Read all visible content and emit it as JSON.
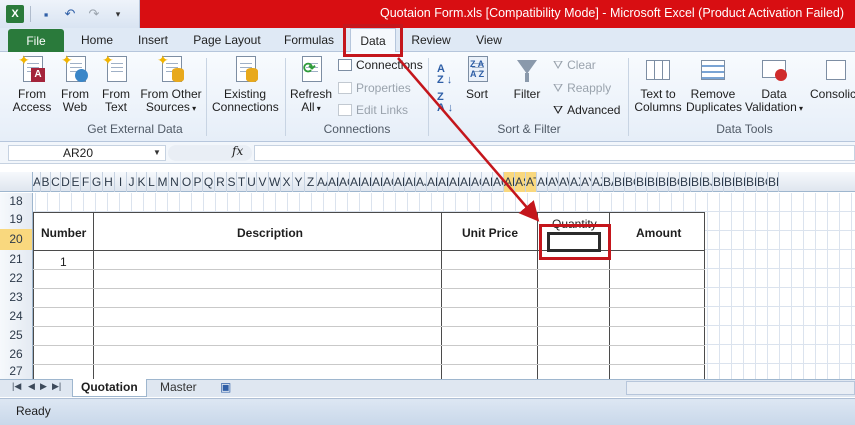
{
  "window": {
    "title": "Quotaion Form.xls  [Compatibility Mode]  -  Microsoft Excel (Product Activation Failed)"
  },
  "tabs": [
    {
      "label": "File"
    },
    {
      "label": "Home"
    },
    {
      "label": "Insert"
    },
    {
      "label": "Page Layout"
    },
    {
      "label": "Formulas"
    },
    {
      "label": "Data"
    },
    {
      "label": "Review"
    },
    {
      "label": "View"
    }
  ],
  "ribbon": {
    "external": {
      "from_access": "From Access",
      "from_web": "From Web",
      "from_text": "From Text",
      "from_other": "From Other Sources",
      "existing": "Existing Connections",
      "group": "Get External Data"
    },
    "connections": {
      "refresh": "Refresh All",
      "connections": "Connections",
      "properties": "Properties",
      "edit_links": "Edit Links",
      "group": "Connections"
    },
    "sort_filter": {
      "sort": "Sort",
      "filter": "Filter",
      "clear": "Clear",
      "reapply": "Reapply",
      "advanced": "Advanced",
      "group": "Sort & Filter"
    },
    "tools": {
      "text_to_columns": "Text to Columns",
      "remove_duplicates": "Remove Duplicates",
      "data_validation": "Data Validation",
      "consolidate": "Consolic",
      "group": "Data Tools"
    }
  },
  "formula": {
    "name_box": "AR20",
    "fx": "fx",
    "value": ""
  },
  "columns": [
    "A",
    "B",
    "C",
    "D",
    "E",
    "F",
    "G",
    "H",
    "I",
    "J",
    "K",
    "L",
    "M",
    "N",
    "O",
    "P",
    "Q",
    "R",
    "S",
    "T",
    "U",
    "V",
    "W",
    "X",
    "Y",
    "Z",
    "AA",
    "AB",
    "AC",
    "AD",
    "AE",
    "AF",
    "AG",
    "AH",
    "AI",
    "AJ",
    "AK",
    "AL",
    "AM",
    "AN",
    "AO",
    "AP",
    "AQ",
    "AR",
    "AS",
    "AT",
    "AU",
    "AV",
    "AW",
    "AX",
    "AY",
    "AZ",
    "BA",
    "BB",
    "BC",
    "BD",
    "BE",
    "BF",
    "BG",
    "BH",
    "BI",
    "BJ",
    "BK",
    "BL",
    "BM",
    "BN",
    "BO",
    "BP"
  ],
  "rows": [
    "18",
    "19",
    "20",
    "21",
    "22",
    "23",
    "24",
    "25",
    "26",
    "27"
  ],
  "form": {
    "number": "Number",
    "description": "Description",
    "unit_price": "Unit Price",
    "quantity": "Quantity",
    "amount": "Amount",
    "first_item": "1"
  },
  "sheets": [
    {
      "label": "Quotation"
    },
    {
      "label": "Master"
    }
  ],
  "status": {
    "ready": "Ready"
  },
  "colors": {
    "title_bar": "#d80e12",
    "file_tab": "#2a7a3b",
    "annotation": "#c4161c",
    "selected_header": "#f9d87e"
  }
}
